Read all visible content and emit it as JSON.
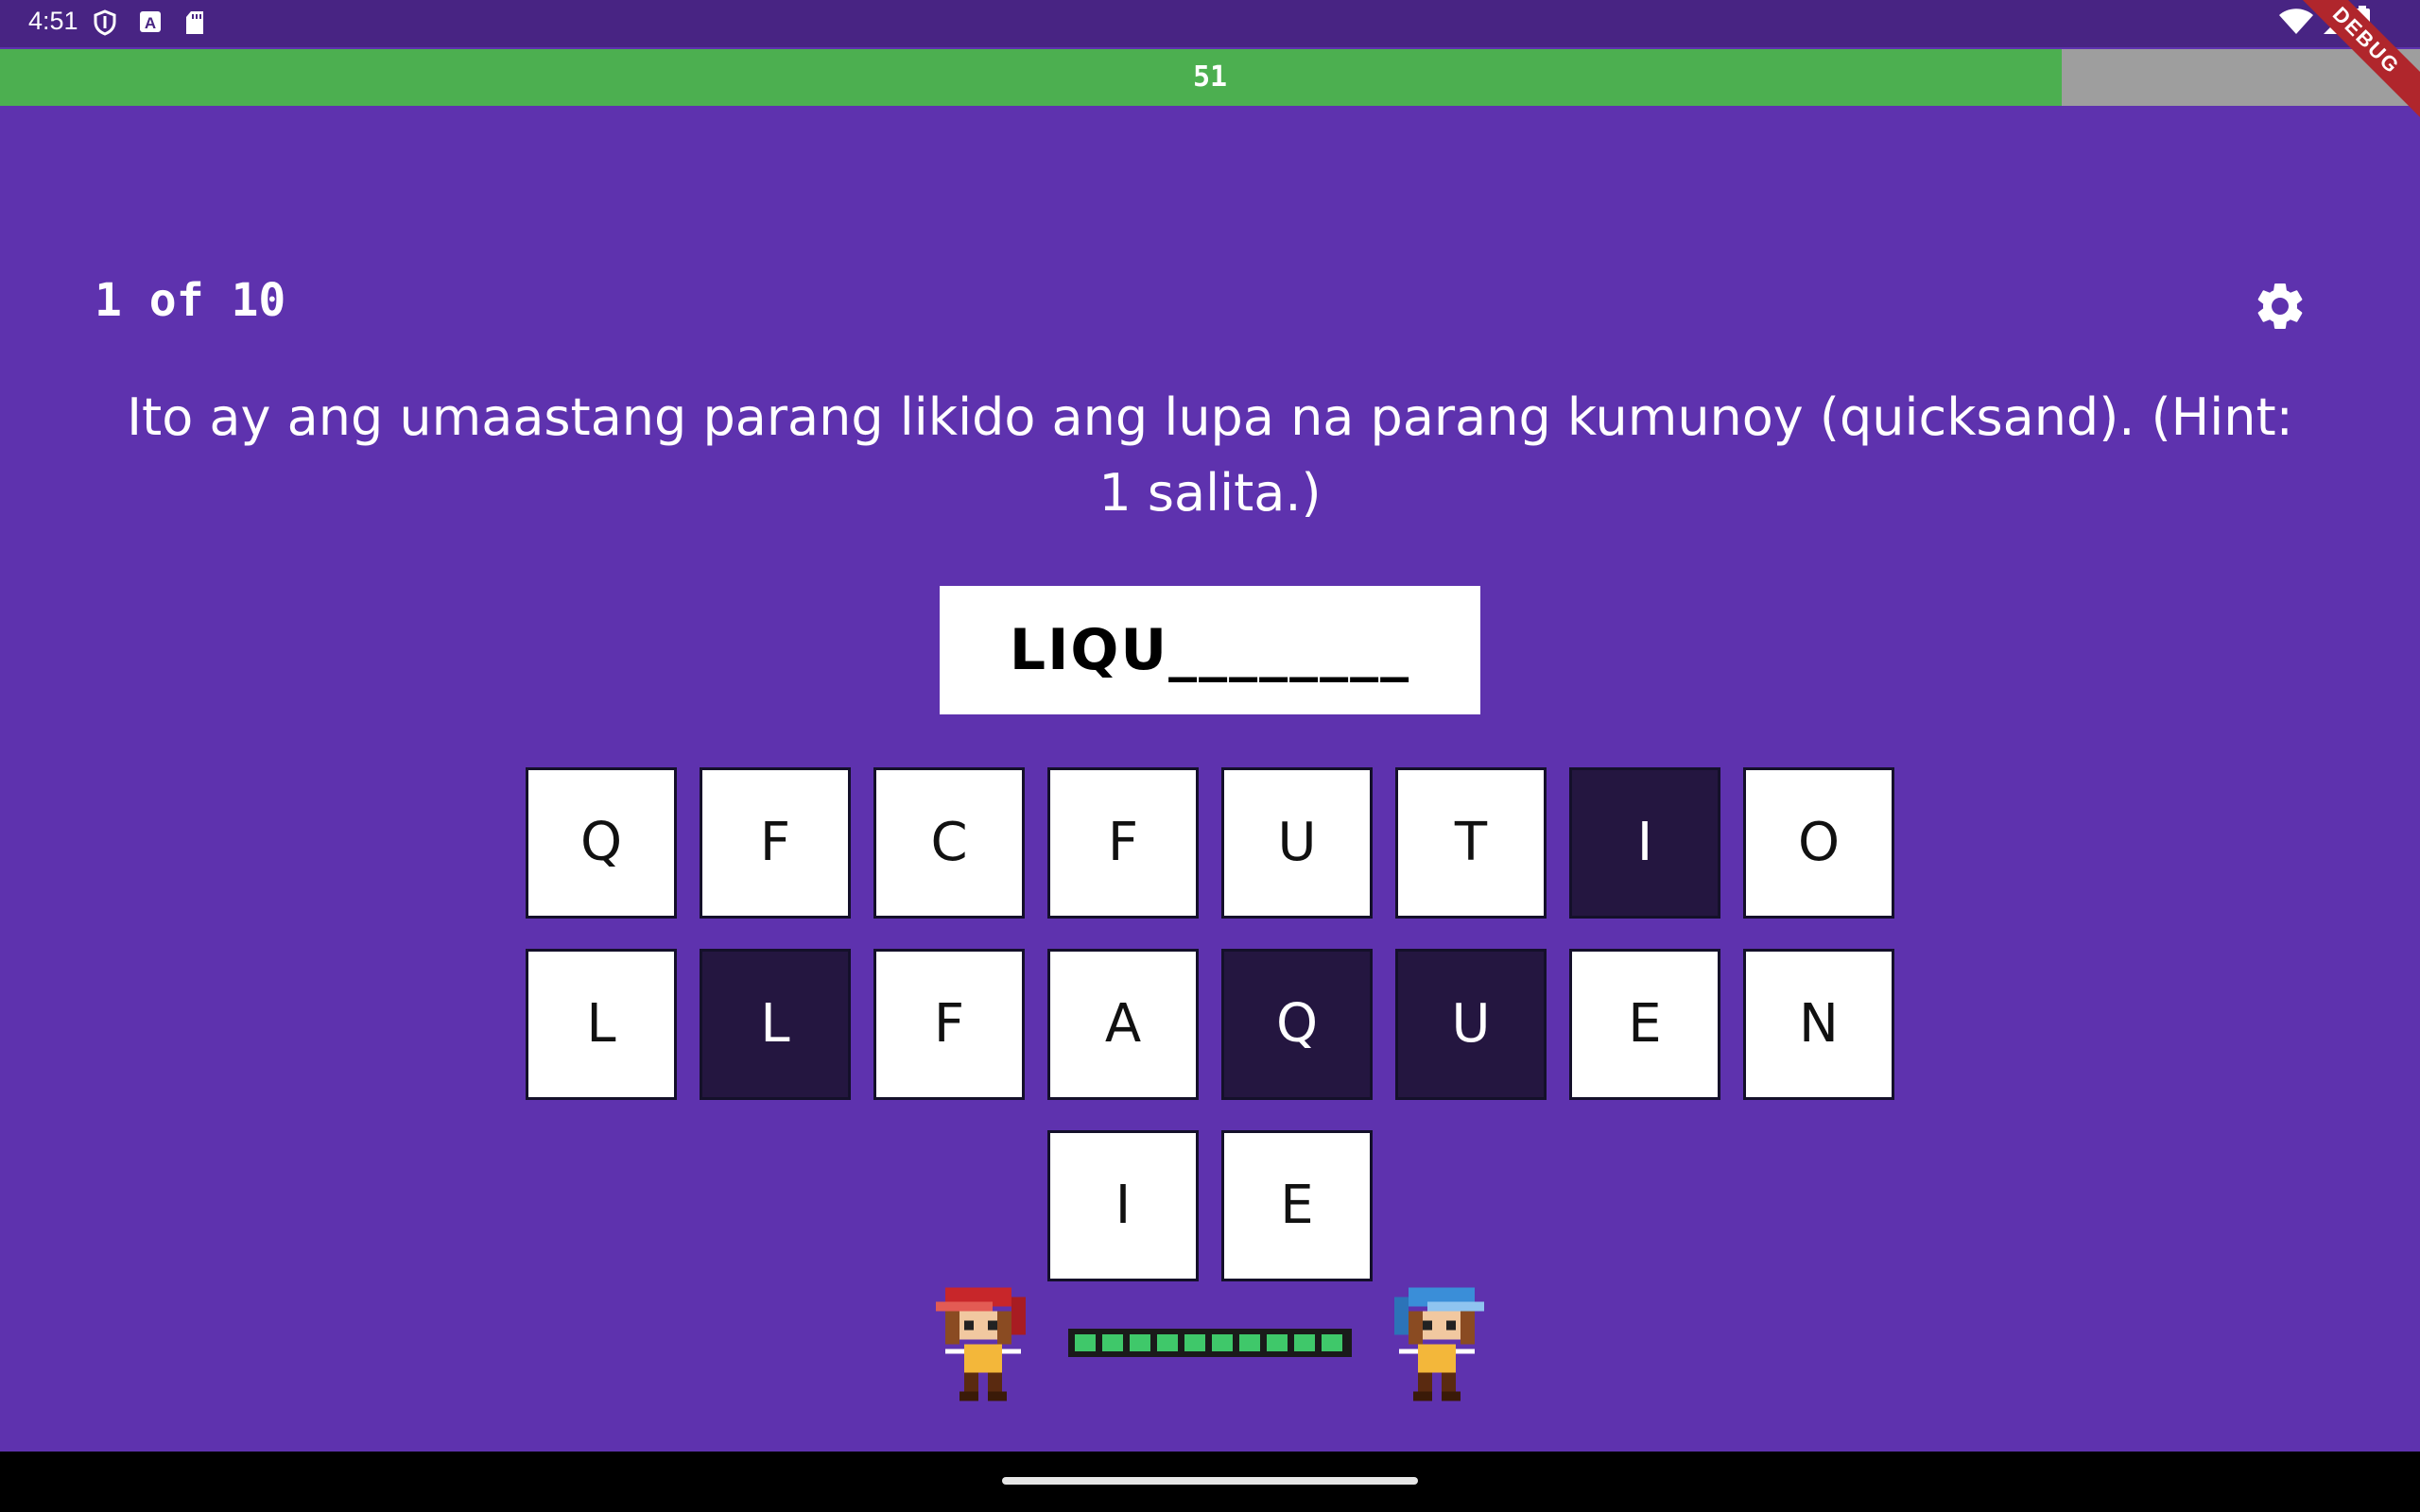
{
  "status_bar": {
    "time": "4:51",
    "left_icons": [
      "shield-icon",
      "a-icon",
      "sd-card-icon"
    ],
    "right_icons": [
      "wifi-icon",
      "signal-icon",
      "battery-icon"
    ]
  },
  "timer": {
    "value": "51",
    "fraction_remaining": 0.852,
    "fill_color": "#4caf50",
    "track_color": "#9e9e9e"
  },
  "debug_banner": "DEBUG",
  "progress": "1 of 10",
  "question": "Ito ay ang umaastang parang likido ang lupa na parang kumunoy (quicksand). (Hint: 1 salita.)",
  "answer": "LIQU________",
  "letters": [
    {
      "letter": "Q",
      "used": false
    },
    {
      "letter": "F",
      "used": false
    },
    {
      "letter": "C",
      "used": false
    },
    {
      "letter": "F",
      "used": false
    },
    {
      "letter": "U",
      "used": false
    },
    {
      "letter": "T",
      "used": false
    },
    {
      "letter": "I",
      "used": true
    },
    {
      "letter": "O",
      "used": false
    },
    {
      "letter": "L",
      "used": false
    },
    {
      "letter": "L",
      "used": true
    },
    {
      "letter": "F",
      "used": false
    },
    {
      "letter": "A",
      "used": false
    },
    {
      "letter": "Q",
      "used": true
    },
    {
      "letter": "U",
      "used": true
    },
    {
      "letter": "E",
      "used": false
    },
    {
      "letter": "N",
      "used": false
    },
    {
      "letter": "I",
      "used": false
    },
    {
      "letter": "E",
      "used": false
    }
  ],
  "hp_segments": 10,
  "colors": {
    "background": "#5e32ae",
    "status_bar": "#482483",
    "tile_used": "#241640",
    "hp": "#3fc86a"
  }
}
